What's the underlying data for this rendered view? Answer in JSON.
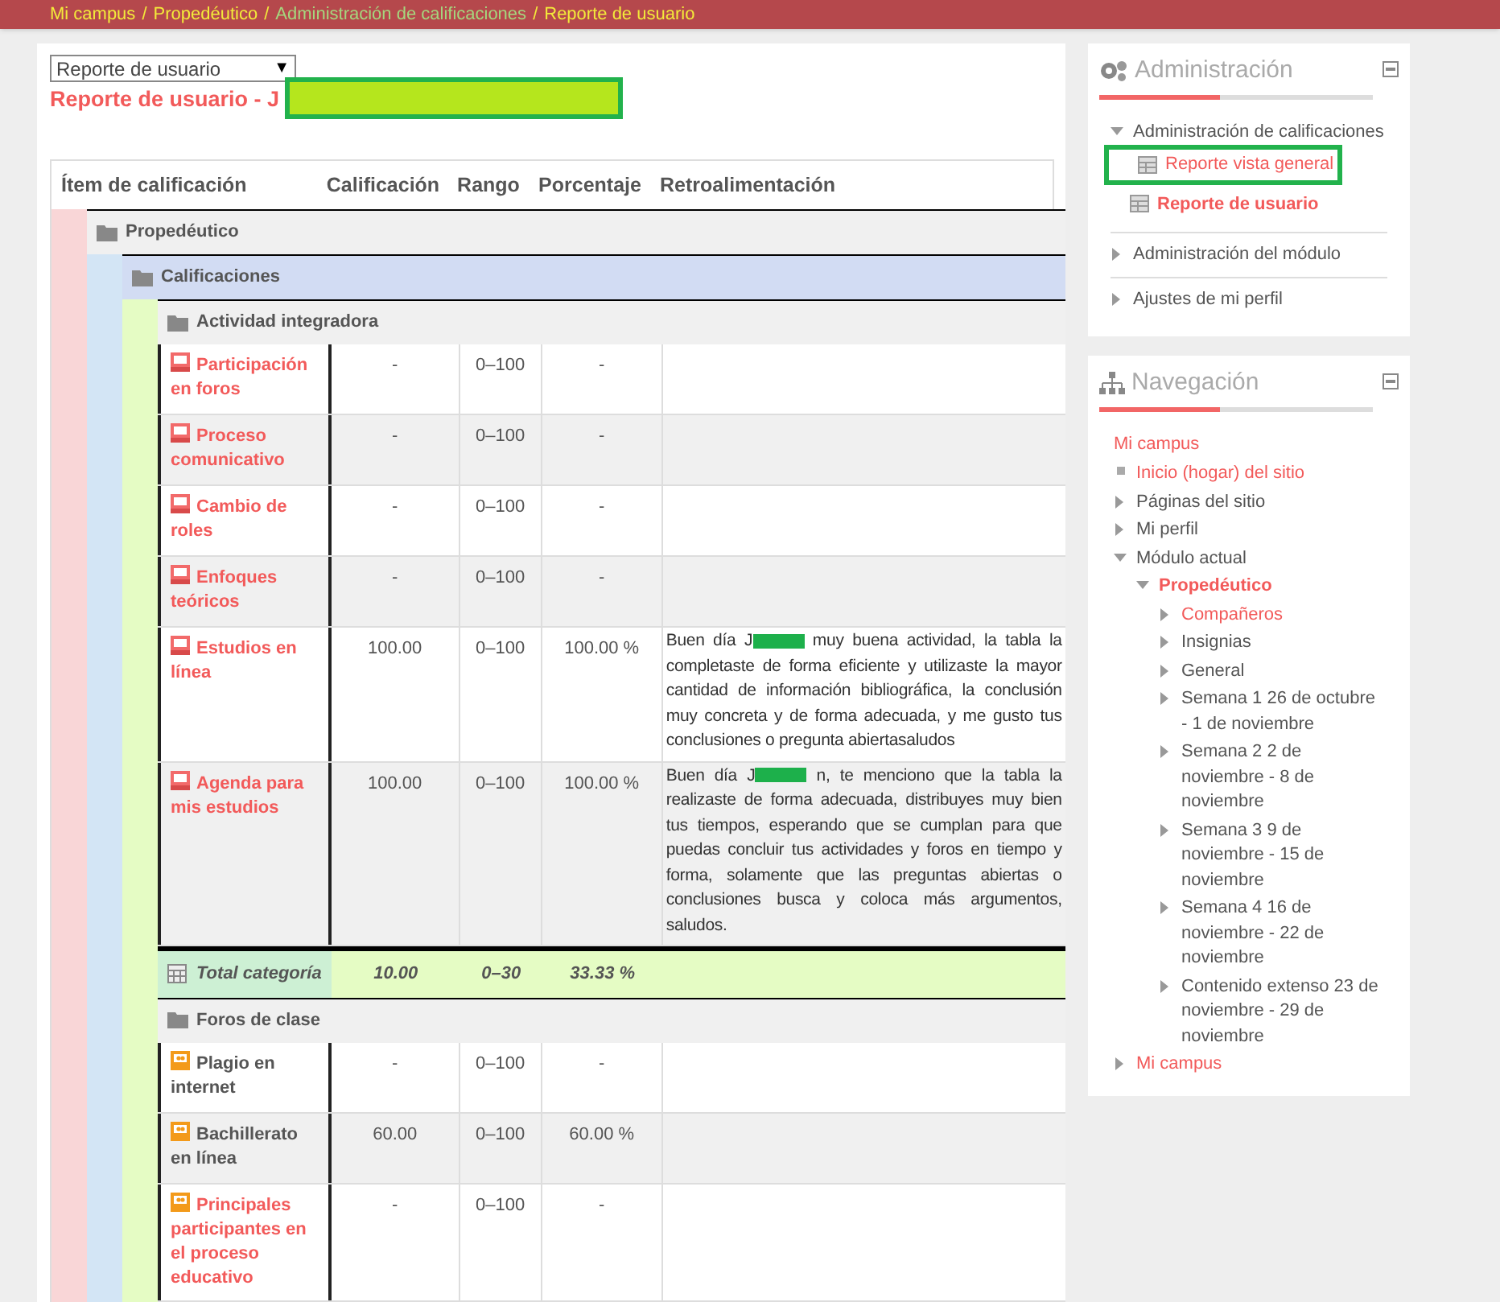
{
  "breadcrumb": [
    {
      "label": "Mi campus",
      "kind": "link",
      "separator": "/"
    },
    {
      "label": "Propedéutico",
      "kind": "link",
      "separator": "/"
    },
    {
      "label": "Administración de calificaciones",
      "kind": "visited",
      "separator": "/"
    },
    {
      "label": "Reporte de usuario",
      "kind": "link"
    }
  ],
  "report_select": {
    "value": "Reporte de usuario",
    "arrow": "▼"
  },
  "heading": {
    "text": "Reporte de usuario - J",
    "redacted": true
  },
  "table": {
    "columns": [
      "Ítem de calificación",
      "Calificación",
      "Rango",
      "Porcentaje",
      "Retroalimentación"
    ],
    "tree": [
      {
        "kind": "category",
        "name": "Propedéutico",
        "children": [
          {
            "kind": "category",
            "name": "Calificaciones",
            "children": [
              {
                "kind": "category",
                "name": "Actividad integradora",
                "children": [
                  {
                    "kind": "assignment",
                    "linked": true,
                    "name": "Participación en foros",
                    "grade": "-",
                    "range": "0–100",
                    "percentage": "-"
                  },
                  {
                    "kind": "assignment",
                    "linked": true,
                    "name": "Proceso comunicativo",
                    "grade": "-",
                    "range": "0–100",
                    "percentage": "-"
                  },
                  {
                    "kind": "assignment",
                    "linked": true,
                    "name": "Cambio de roles",
                    "grade": "-",
                    "range": "0–100",
                    "percentage": "-"
                  },
                  {
                    "kind": "assignment",
                    "linked": true,
                    "name": "Enfoques teóricos",
                    "grade": "-",
                    "range": "0–100",
                    "percentage": "-"
                  },
                  {
                    "kind": "assignment",
                    "linked": true,
                    "name": "Estudios en línea",
                    "grade": "100.00",
                    "range": "0–100",
                    "percentage": "100.00 %",
                    "feedback": {
                      "before": "Buen día J",
                      "redacted": true,
                      "after": "muy buena actividad, la tabla la completaste de forma eficiente y utilizaste la mayor cantidad de información bibliográfica, la conclusión muy concreta y de forma adecuada, y me gusto tus conclusiones o pregunta abiertasaludos"
                    }
                  },
                  {
                    "kind": "assignment",
                    "linked": true,
                    "name": "Agenda para mis estudios",
                    "grade": "100.00",
                    "range": "0–100",
                    "percentage": "100.00 %",
                    "feedback": {
                      "before": "Buen día J",
                      "redacted": true,
                      "after": "n, te menciono que la tabla la realizaste de forma adecuada, distribuyes muy bien tus tiempos, esperando que se cumplan para que puedas concluir tus actividades y foros en tiempo y forma, solamente que las preguntas abiertas o conclusiones busca y coloca más argumentos, saludos."
                    }
                  },
                  {
                    "kind": "total",
                    "name": "Total categoría",
                    "grade": "10.00",
                    "range": "0–30",
                    "percentage": "33.33 %"
                  }
                ]
              },
              {
                "kind": "category",
                "name": "Foros de clase",
                "children": [
                  {
                    "kind": "forum",
                    "linked": false,
                    "name": "Plagio en internet",
                    "grade": "-",
                    "range": "0–100",
                    "percentage": "-"
                  },
                  {
                    "kind": "forum",
                    "linked": false,
                    "name": "Bachillerato en línea",
                    "grade": "60.00",
                    "range": "0–100",
                    "percentage": "60.00 %"
                  },
                  {
                    "kind": "forum",
                    "linked": true,
                    "name": "Principales participantes en el proceso educativo",
                    "grade": "-",
                    "range": "0–100",
                    "percentage": "-"
                  }
                ]
              }
            ]
          }
        ]
      }
    ]
  },
  "administration": {
    "title": "Administración",
    "items": [
      {
        "label": "Administración de calificaciones",
        "kind": "branch",
        "expanded": true,
        "children": [
          {
            "label": "Reporte vista general",
            "kind": "report",
            "current": false,
            "highlighted": true
          },
          {
            "label": "Reporte de usuario",
            "kind": "report",
            "current": true,
            "highlighted": false
          }
        ]
      },
      {
        "label": "Administración del módulo",
        "kind": "branch",
        "expanded": false
      },
      {
        "label": "Ajustes de mi perfil",
        "kind": "branch",
        "expanded": false
      }
    ]
  },
  "navigation": {
    "title": "Navegación",
    "root": "Mi campus",
    "items": [
      {
        "label": "Inicio (hogar) del sitio",
        "kind": "leaf",
        "linked": true,
        "current": false
      },
      {
        "label": "Páginas del sitio",
        "kind": "branch",
        "expanded": false,
        "linked": false,
        "current": false
      },
      {
        "label": "Mi perfil",
        "kind": "branch",
        "expanded": false,
        "linked": false,
        "current": false
      },
      {
        "label": "Módulo actual",
        "kind": "branch",
        "expanded": true,
        "linked": false,
        "current": false,
        "children": [
          {
            "label": "Propedéutico",
            "kind": "branch",
            "expanded": true,
            "linked": true,
            "current": true,
            "children": [
              {
                "label": "Compañeros",
                "kind": "branch",
                "expanded": false,
                "linked": true,
                "current": false
              },
              {
                "label": "Insignias",
                "kind": "branch",
                "expanded": false,
                "linked": false,
                "current": false
              },
              {
                "label": "General",
                "kind": "branch",
                "expanded": false,
                "linked": false,
                "current": false
              },
              {
                "label": "Semana 1 26 de octubre - 1 de noviembre",
                "kind": "branch",
                "expanded": false,
                "linked": false,
                "current": false
              },
              {
                "label": "Semana 2 2 de noviembre - 8 de noviembre",
                "kind": "branch",
                "expanded": false,
                "linked": false,
                "current": false
              },
              {
                "label": "Semana 3 9 de noviembre - 15 de noviembre",
                "kind": "branch",
                "expanded": false,
                "linked": false,
                "current": false
              },
              {
                "label": "Semana 4 16 de noviembre - 22 de noviembre",
                "kind": "branch",
                "expanded": false,
                "linked": false,
                "current": false
              },
              {
                "label": "Contenido extenso 23 de noviembre - 29 de noviembre",
                "kind": "branch",
                "expanded": false,
                "linked": false,
                "current": false
              }
            ]
          }
        ]
      },
      {
        "label": "Mi campus",
        "kind": "branch",
        "expanded": false,
        "linked": true,
        "current": false
      }
    ]
  }
}
